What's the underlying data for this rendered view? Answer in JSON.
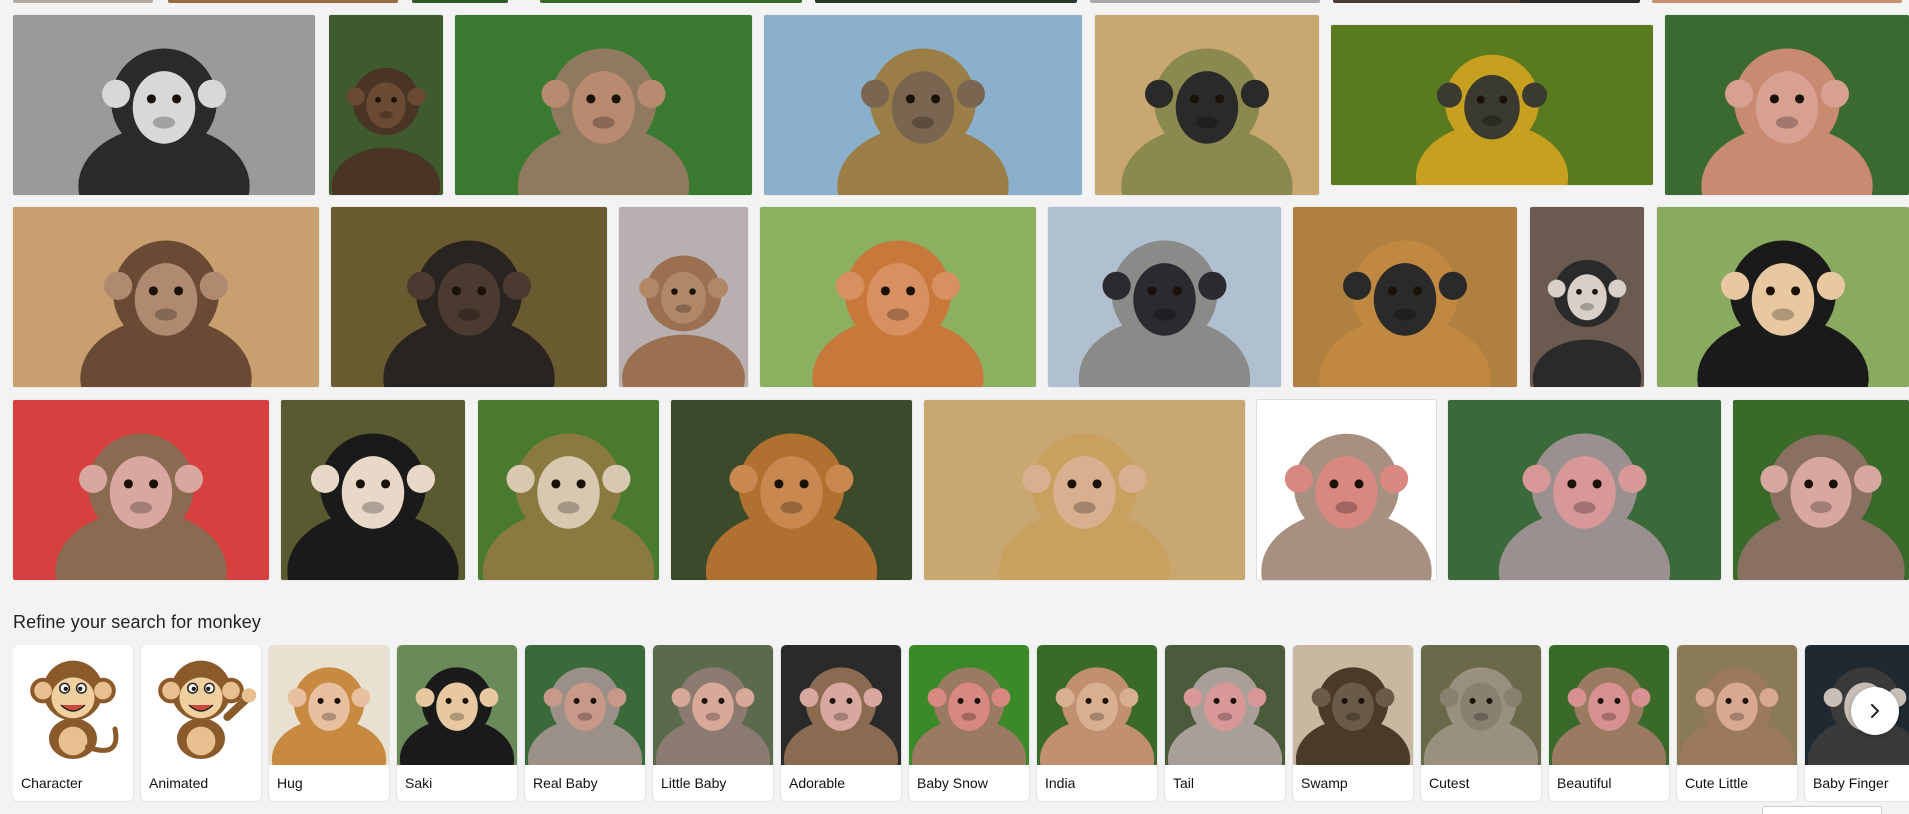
{
  "refine": {
    "title": "Refine your search for monkey",
    "cards": [
      {
        "label": "Character",
        "style": "cartoon"
      },
      {
        "label": "Animated",
        "style": "cartoon"
      },
      {
        "label": "Hug",
        "style": "photo"
      },
      {
        "label": "Saki",
        "style": "photo"
      },
      {
        "label": "Real Baby",
        "style": "photo"
      },
      {
        "label": "Little Baby",
        "style": "photo"
      },
      {
        "label": "Adorable",
        "style": "photo"
      },
      {
        "label": "Baby Snow",
        "style": "photo"
      },
      {
        "label": "India",
        "style": "photo"
      },
      {
        "label": "Tail",
        "style": "photo"
      },
      {
        "label": "Swamp",
        "style": "photo"
      },
      {
        "label": "Cutest",
        "style": "photo"
      },
      {
        "label": "Beautiful",
        "style": "photo"
      },
      {
        "label": "Cute Little",
        "style": "photo"
      },
      {
        "label": "Baby Finger",
        "style": "photo"
      }
    ]
  },
  "icons": {
    "next": "chevron-right-icon"
  },
  "colors": {
    "page_bg": "#f3f3f3",
    "card_bg": "#ffffff",
    "text": "#111111"
  },
  "image_results": {
    "row1": [
      {
        "bg": "#9a9a9a",
        "fur": "#2a2a2a",
        "face": "#d8d8d8"
      },
      {
        "bg": "#3f5a2e",
        "fur": "#4a3424",
        "face": "#6b4a33"
      },
      {
        "bg": "#3a7a30",
        "fur": "#8f7a60",
        "face": "#b88a70"
      },
      {
        "bg": "#8ab0cc",
        "fur": "#9a7e45",
        "face": "#7a6650"
      },
      {
        "bg": "#c8a870",
        "fur": "#8a8a50",
        "face": "#2a2a2a"
      },
      {
        "bg": "#5a7a20",
        "fur": "#c8a020",
        "face": "#3a3a30"
      },
      {
        "bg": "#3a6a30",
        "fur": "#c88a70",
        "face": "#d8a090"
      }
    ],
    "row2": [
      {
        "bg": "#c8a070",
        "fur": "#6a4a35",
        "face": "#b08a70"
      },
      {
        "bg": "#6a5a30",
        "fur": "#2a2420",
        "face": "#4a3a30"
      },
      {
        "bg": "#b8b0b0",
        "fur": "#9a7050",
        "face": "#b08868"
      },
      {
        "bg": "#8ab060",
        "fur": "#c8783a",
        "face": "#d89060"
      },
      {
        "bg": "#b0c0d0",
        "fur": "#8a8a88",
        "face": "#2a2a30"
      },
      {
        "bg": "#b08040",
        "fur": "#c08840",
        "face": "#2a2a2a"
      },
      {
        "bg": "#6a5a50",
        "fur": "#2a2a2a",
        "face": "#d8d0c8"
      },
      {
        "bg": "#8aaa60",
        "fur": "#1a1a1a",
        "face": "#e8c8a0"
      }
    ],
    "row3": [
      {
        "bg": "#d84040",
        "fur": "#8a6a50",
        "face": "#d8a8a0"
      },
      {
        "bg": "#5a5a30",
        "fur": "#1a1a1a",
        "face": "#e8d8c8"
      },
      {
        "bg": "#4a7a30",
        "fur": "#8a7a40",
        "face": "#d8c8b0"
      },
      {
        "bg": "#3a4a2a",
        "fur": "#b07030",
        "face": "#c88850"
      },
      {
        "bg": "#c8a870",
        "fur": "#c8a060",
        "face": "#d8b090"
      },
      {
        "bg": "#ffffff",
        "fur": "#a89080",
        "face": "#d88880"
      },
      {
        "bg": "#3a6a3a",
        "fur": "#9a9090",
        "face": "#d89898"
      },
      {
        "bg": "#3a6a2a",
        "fur": "#8a7060",
        "face": "#d8a8a0"
      }
    ]
  }
}
